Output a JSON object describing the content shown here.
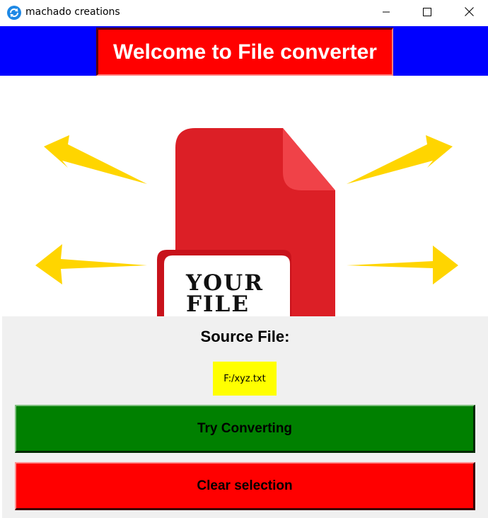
{
  "window": {
    "title": "machado creations",
    "app_icon": "refresh-icon",
    "controls": [
      "minimize-icon",
      "maximize-icon",
      "close-icon"
    ]
  },
  "header": {
    "title": "Welcome to File converter",
    "background_color": "#0000ff",
    "title_box_color": "#ff0000"
  },
  "illustration": {
    "document_text_line1": "YOUR",
    "document_text_line2": "FILE",
    "document_color": "#dc1f26",
    "arrow_color": "#ffd500"
  },
  "panel": {
    "source_label": "Source File:",
    "file_path": "F:/xyz.txt",
    "convert_label": "Try Converting",
    "clear_label": "Clear selection",
    "convert_color": "#008000",
    "clear_color": "#ff0000",
    "file_path_color": "#ffff00"
  }
}
